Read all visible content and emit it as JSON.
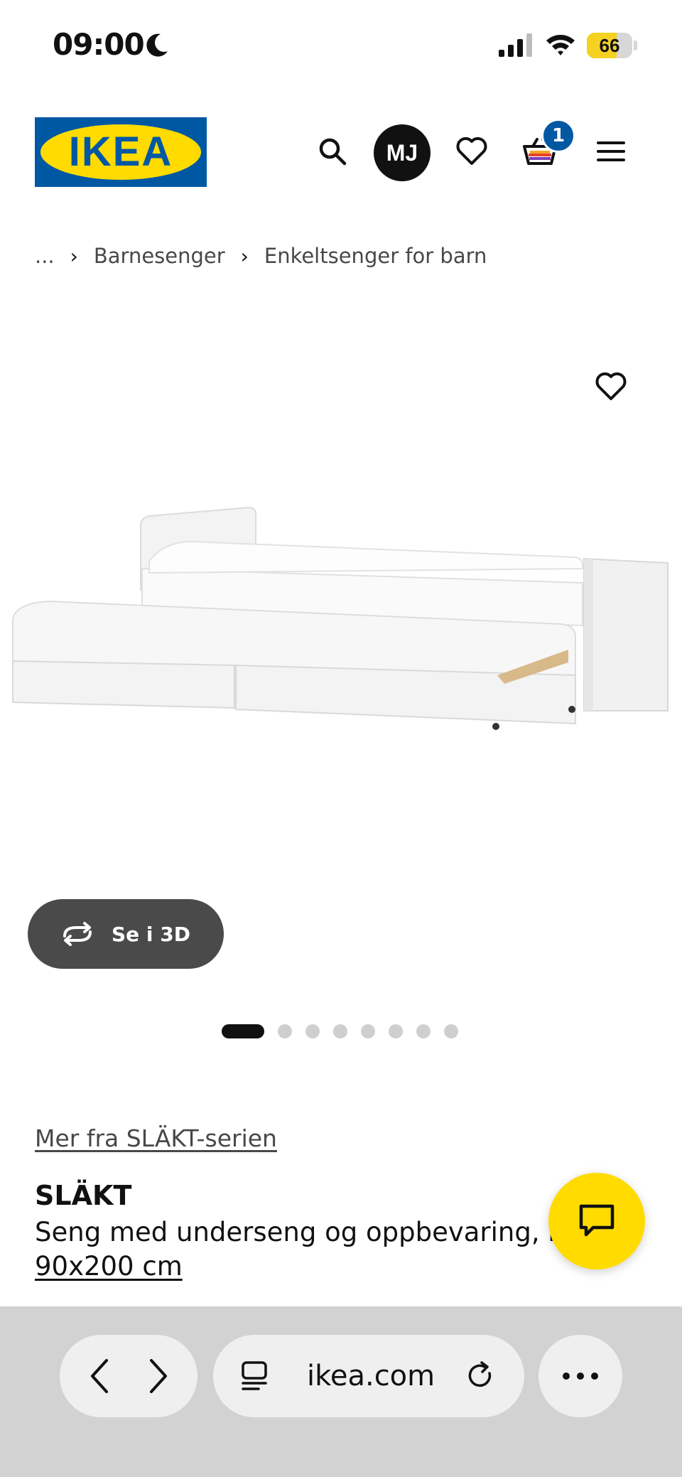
{
  "status_bar": {
    "time": "09:00",
    "battery": "66",
    "battery_level_percent": 66
  },
  "header": {
    "logo_text": "IKEA",
    "avatar_initials": "MJ",
    "cart_count": "1",
    "icons": [
      "search-icon",
      "heart-icon",
      "cart-icon",
      "menu-icon"
    ]
  },
  "breadcrumb": {
    "items": [
      "...",
      "Barnesenger",
      "Enkeltsenger for barn"
    ]
  },
  "media": {
    "view_3d_label": "Se i 3D",
    "total_images": 8,
    "active_image_index": 0
  },
  "product": {
    "series_link": "Mer fra SLÄKT-serien",
    "name": "SLÄKT",
    "description": "Seng med underseng og oppbevaring, h",
    "size": "90x200 cm"
  },
  "browser": {
    "url": "ikea.com"
  },
  "colors": {
    "ikea_blue": "#0058a3",
    "ikea_yellow": "#ffdb00",
    "dark_button": "#4a4a4a"
  }
}
